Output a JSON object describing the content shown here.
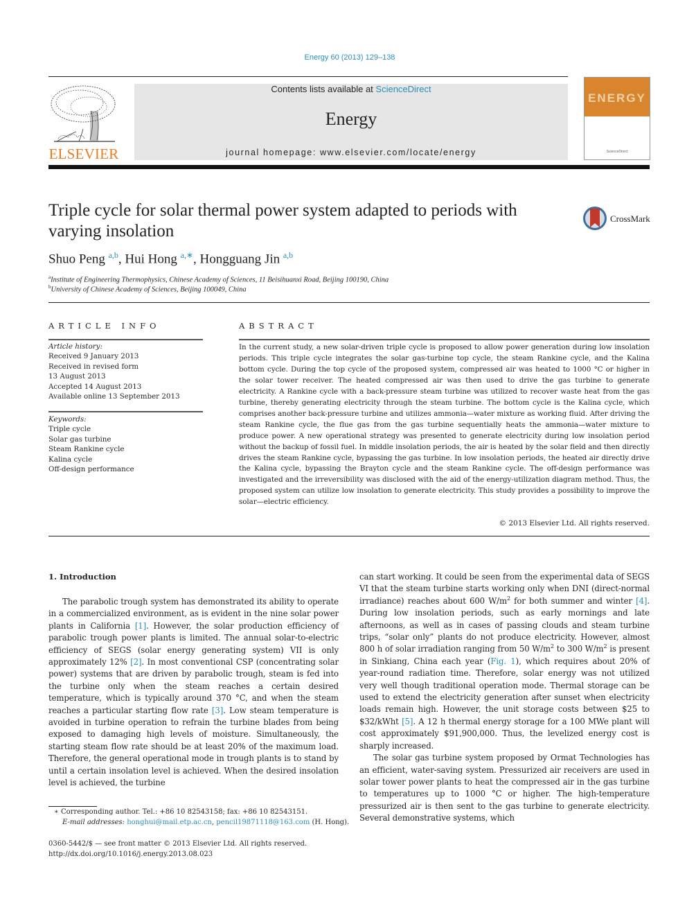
{
  "citation": "Energy 60 (2013) 129–138",
  "header": {
    "contents_prefix": "Contents lists available at ",
    "contents_link": "ScienceDirect",
    "journal_name": "Energy",
    "homepage": "journal homepage: www.elsevier.com/locate/energy",
    "publisher_logo_text": "ELSEVIER",
    "cover_word": "ENERGY",
    "cover_small": "ScienceDirect"
  },
  "colors": {
    "link": "#2a8dbb",
    "elsevier_orange": "#f07a1e",
    "cover_orange": "#d9852e",
    "header_gray": "#e6e6e6",
    "crossmark_red": "#c0392b",
    "crossmark_blue": "#3b6fa0"
  },
  "article": {
    "title": "Triple cycle for solar thermal power system adapted to periods with varying insolation",
    "crossmark_label": "CrossMark",
    "authors": [
      {
        "name": "Shuo Peng",
        "sup": "a,b"
      },
      {
        "name": "Hui Hong",
        "sup": "a,∗"
      },
      {
        "name": "Hongguang Jin",
        "sup": "a,b"
      }
    ],
    "affiliations": [
      {
        "key": "a",
        "text": "Institute of Engineering Thermophysics, Chinese Academy of Sciences, 11 Beisihuanxi Road, Beijing 100190, China"
      },
      {
        "key": "b",
        "text": "University of Chinese Academy of Sciences, Beijing 100049, China"
      }
    ]
  },
  "article_info": {
    "heading": "ARTICLE INFO",
    "history_label": "Article history:",
    "history": [
      "Received 9 January 2013",
      "Received in revised form",
      "13 August 2013",
      "Accepted 14 August 2013",
      "Available online 13 September 2013"
    ],
    "keywords_label": "Keywords:",
    "keywords": [
      "Triple cycle",
      "Solar gas turbine",
      "Steam Rankine cycle",
      "Kalina cycle",
      "Off-design performance"
    ]
  },
  "abstract": {
    "heading": "ABSTRACT",
    "text": "In the current study, a new solar-driven triple cycle is proposed to allow power generation during low insolation periods. This triple cycle integrates the solar gas-turbine top cycle, the steam Rankine cycle, and the Kalina bottom cycle. During the top cycle of the proposed system, compressed air was heated to 1000 °C or higher in the solar tower receiver. The heated compressed air was then used to drive the gas turbine to generate electricity. A Rankine cycle with a back-pressure steam turbine was utilized to recover waste heat from the gas turbine, thereby generating electricity through the steam turbine. The bottom cycle is the Kalina cycle, which comprises another back-pressure turbine and utilizes ammonia—water mixture as working fluid. After driving the steam Rankine cycle, the flue gas from the gas turbine sequentially heats the ammonia—water mixture to produce power. A new operational strategy was presented to generate electricity during low insolation period without the backup of fossil fuel. In middle insolation periods, the air is heated by the solar field and then directly drives the steam Rankine cycle, bypassing the gas turbine. In low insolation periods, the heated air directly drive the Kalina cycle, bypassing the Brayton cycle and the steam Rankine cycle. The off-design performance was investigated and the irreversibility was disclosed with the aid of the energy-utilization diagram method. Thus, the proposed system can utilize low insolation to generate electricity. This study provides a possibility to improve the solar—electric efficiency.",
    "copyright": "© 2013 Elsevier Ltd. All rights reserved."
  },
  "intro": {
    "heading": "1.  Introduction",
    "left": {
      "p1_a": "The parabolic trough system has demonstrated its ability to operate in a commercialized environment, as is evident in the nine solar power plants in California ",
      "ref1": "[1]",
      "p1_b": ". However, the solar production efficiency of parabolic trough power plants is limited. The annual solar-to-electric efficiency of SEGS (solar energy generating system) VII is only approximately 12% ",
      "ref2": "[2]",
      "p1_c": ". In most conventional CSP (concentrating solar power) systems that are driven by parabolic trough, steam is fed into the turbine only when the steam reaches a certain desired temperature, which is typically around 370 °C, and when the steam reaches a particular starting flow rate ",
      "ref3": "[3]",
      "p1_d": ". Low steam temperature is avoided in turbine operation to refrain the turbine blades from being exposed to damaging high levels of moisture. Simultaneously, the starting steam flow rate should be at least 20% of the maximum load. Therefore, the general operational mode in trough plants is to stand by until a certain insolation level is achieved. When the desired insolation level is achieved, the turbine"
    },
    "right": {
      "p1_a": "can start working. It could be seen from the experimental data of SEGS VI that the steam turbine starts working only when DNI (direct-normal irradiance) reaches about 600 W/m",
      "sup2": "2",
      "p1_b": " for both summer and winter ",
      "ref4": "[4]",
      "p1_c": ". During low insolation periods, such as early mornings and late afternoons, as well as in cases of passing clouds and steam turbine trips, “solar only” plants do not produce electricity. However, almost 800 h of solar irradiation ranging from 50 W/m",
      "p1_d": " to 300 W/m",
      "p1_e": " is present in Sinkiang, China each year (",
      "fig1": "Fig. 1",
      "p1_f": "), which requires about 20% of year-round radiation time. Therefore, solar energy was not utilized very well though traditional operation mode. Thermal storage can be used to extend the electricity generation after sunset when electricity loads remain high. However, the unit storage costs between $25 to $32/kWht ",
      "ref5": "[5]",
      "p1_g": ". A 12 h thermal energy storage for a 100 MWe plant will cost approximately $91,900,000. Thus, the levelized energy cost is sharply increased.",
      "p2": "The solar gas turbine system proposed by Ormat Technologies has an efficient, water-saving system. Pressurized air receivers are used in solar tower power plants to heat the compressed air in the gas turbine to temperatures up to 1000 °C or higher. The high-temperature pressurized air is then sent to the gas turbine to generate electricity. Several demonstrative systems, which"
    }
  },
  "footnotes": {
    "corresponding": "∗  Corresponding author. Tel.: +86 10 82543158; fax: +86 10 82543151.",
    "email_label": "E-mail addresses:",
    "email1": "honghui@mail.etp.ac.cn",
    "email_sep": ", ",
    "email2": "pencil19871118@163.com",
    "email_suffix": " (H. Hong).",
    "front_matter": "0360-5442/$ — see front matter © 2013 Elsevier Ltd. All rights reserved.",
    "doi": "http://dx.doi.org/10.1016/j.energy.2013.08.023"
  }
}
